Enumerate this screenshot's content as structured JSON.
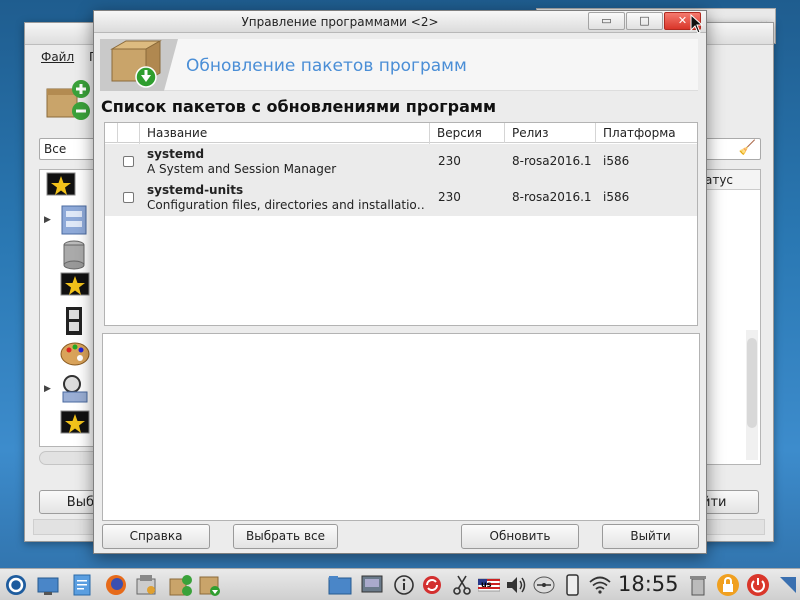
{
  "background_window": {
    "menu_file": "Файл",
    "menu_second": "П",
    "filter_value": "Все",
    "status_col_partial": "татус",
    "select_partial": "Выб",
    "exit_partial": "йти"
  },
  "dialog": {
    "title": "Управление программами <2>",
    "banner_title": "Обновление пакетов программ",
    "section_title": "Список пакетов с обновлениями программ",
    "columns": {
      "name": "Название",
      "version": "Версия",
      "release": "Релиз",
      "platform": "Платформа"
    },
    "rows": [
      {
        "name": "systemd",
        "summary": "A System and Session Manager",
        "version": "230",
        "release": "8-rosa2016.1",
        "platform": "i586"
      },
      {
        "name": "systemd-units",
        "summary": "Configuration files, directories and installatio…",
        "version": "230",
        "release": "8-rosa2016.1",
        "platform": "i586"
      }
    ],
    "buttons": {
      "help": "Справка",
      "select_all": "Выбрать все",
      "update": "Обновить",
      "quit": "Выйти"
    },
    "window_controls": {
      "minimize": "▭",
      "maximize": "□",
      "close": "✕"
    }
  },
  "taskbar": {
    "clock": "18:55",
    "keyboard_layout": "us"
  },
  "colors": {
    "accent_blue": "#4a8ed6",
    "close_red": "#d9362a",
    "desktop_blue": "#2a78b3"
  }
}
